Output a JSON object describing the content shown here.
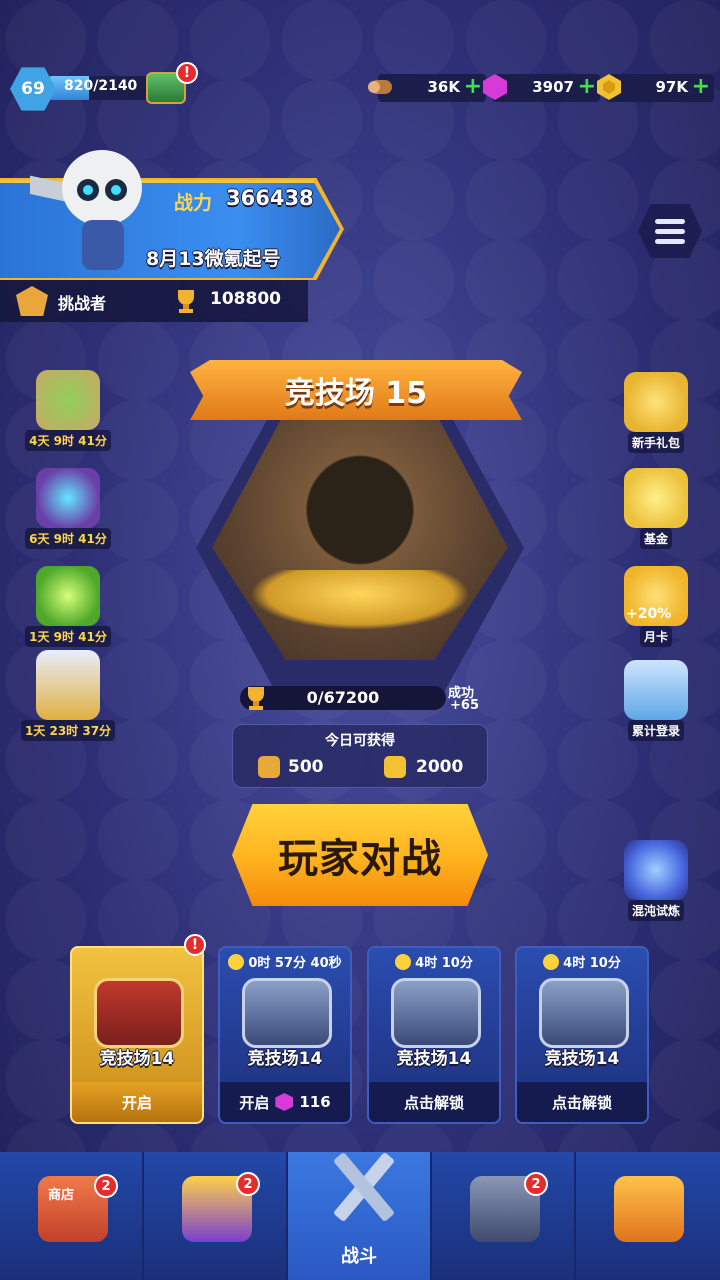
{
  "top_bar": {
    "level": "69",
    "xp_text": "820/2140",
    "xp_progress": 0.38,
    "resources": [
      {
        "icon": "wood-icon",
        "value": "36K",
        "plus": "+"
      },
      {
        "icon": "gem-icon",
        "value": "3907",
        "plus": "+"
      },
      {
        "icon": "gold-coin-icon",
        "value": "97K",
        "plus": "+"
      }
    ],
    "alert": "!"
  },
  "player": {
    "power_label": "战力",
    "power_value": "366438",
    "name": "8月13微氪起号",
    "rank_label": "挑战者",
    "trophies": "108800"
  },
  "left_events": [
    {
      "name": "event-scroll",
      "days": "4天",
      "time": "9时 41分",
      "color": "#c9a865"
    },
    {
      "name": "event-orb",
      "days": "6天",
      "time": "9时 41分",
      "color": "#6a3fa8"
    },
    {
      "name": "event-potion",
      "days": "1天",
      "time": "9时 41分",
      "color": "#7ed04a"
    },
    {
      "name": "event-hero",
      "days": "1天",
      "time": "23时 37分",
      "color": "#e0b040"
    }
  ],
  "right_events": [
    {
      "name": "新手礼包",
      "color": "#e8b532"
    },
    {
      "name": "基金",
      "color": "#ecc23c"
    },
    {
      "name": "月卡",
      "color": "#f0b52a",
      "extra": "+20%"
    },
    {
      "name": "累计登录",
      "color": "#5fa6e6"
    },
    {
      "name": "混沌试炼",
      "color": "#4a6ae0"
    }
  ],
  "arena": {
    "title": "竞技场  15",
    "progress_text": "0/67200",
    "win_label": "成功",
    "win_value": "+65",
    "today_title": "今日可获得",
    "reward1": "500",
    "reward2": "2000",
    "battle_label": "玩家对战"
  },
  "chests": [
    {
      "timer": "",
      "name": "竞技场14",
      "footer": "开启",
      "cost": "",
      "active": true
    },
    {
      "timer": "0时 57分 40秒",
      "name": "竞技场14",
      "footer": "开启",
      "cost": "116",
      "active": false
    },
    {
      "timer": "4时 10分",
      "name": "竞技场14",
      "footer": "点击解锁",
      "cost": "",
      "active": false
    },
    {
      "timer": "4时 10分",
      "name": "竞技场14",
      "footer": "点击解锁",
      "cost": "",
      "active": false
    }
  ],
  "nav": [
    {
      "icon": "shop-icon",
      "label": "商店",
      "badge": "2"
    },
    {
      "icon": "shield-icon",
      "label": "",
      "badge": "2"
    },
    {
      "icon": "crossed-swords-icon",
      "label": "战斗",
      "badge": ""
    },
    {
      "icon": "tower-icon",
      "label": "",
      "badge": "2"
    },
    {
      "icon": "fist-icon",
      "label": "",
      "badge": ""
    }
  ],
  "colors": {
    "accent": "#ffb21d",
    "panel": "#2a4db0",
    "alert": "#e52c2c"
  }
}
